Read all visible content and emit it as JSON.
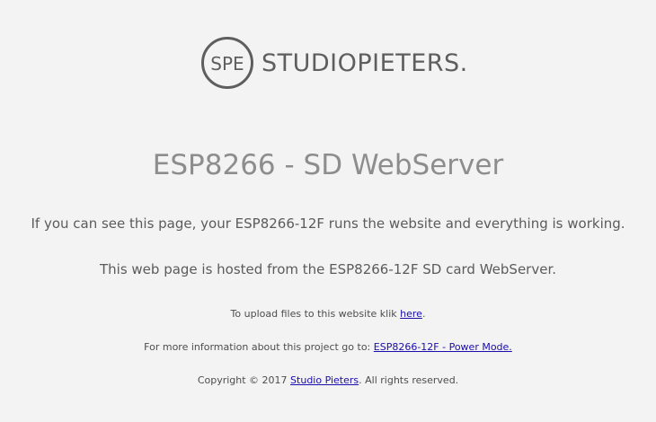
{
  "logo": {
    "mark_text": "SPE",
    "brand_text": "STUDIOPIETERS."
  },
  "heading": {
    "title": "ESP8266 - SD WebServer"
  },
  "body": {
    "line1": "If you can see this page, your ESP8266-12F runs the website and everything is working.",
    "line2": "This web page is hosted from the ESP8266-12F SD card WebServer."
  },
  "upload": {
    "prefix": "To upload files to this website klik ",
    "link_text": "here",
    "suffix": "."
  },
  "info": {
    "prefix": "For more information about this project go to: ",
    "link_text": "ESP8266-12F - Power Mode.",
    "suffix": ""
  },
  "footer": {
    "prefix": "Copyright © 2017 ",
    "link_text": "Studio Pieters",
    "suffix": ". All rights reserved."
  },
  "colors": {
    "background": "#f3f3f3",
    "title": "#8d8d8d",
    "text": "#5b5b5b",
    "link": "#1a0dab",
    "logo": "#5e5e5e"
  }
}
